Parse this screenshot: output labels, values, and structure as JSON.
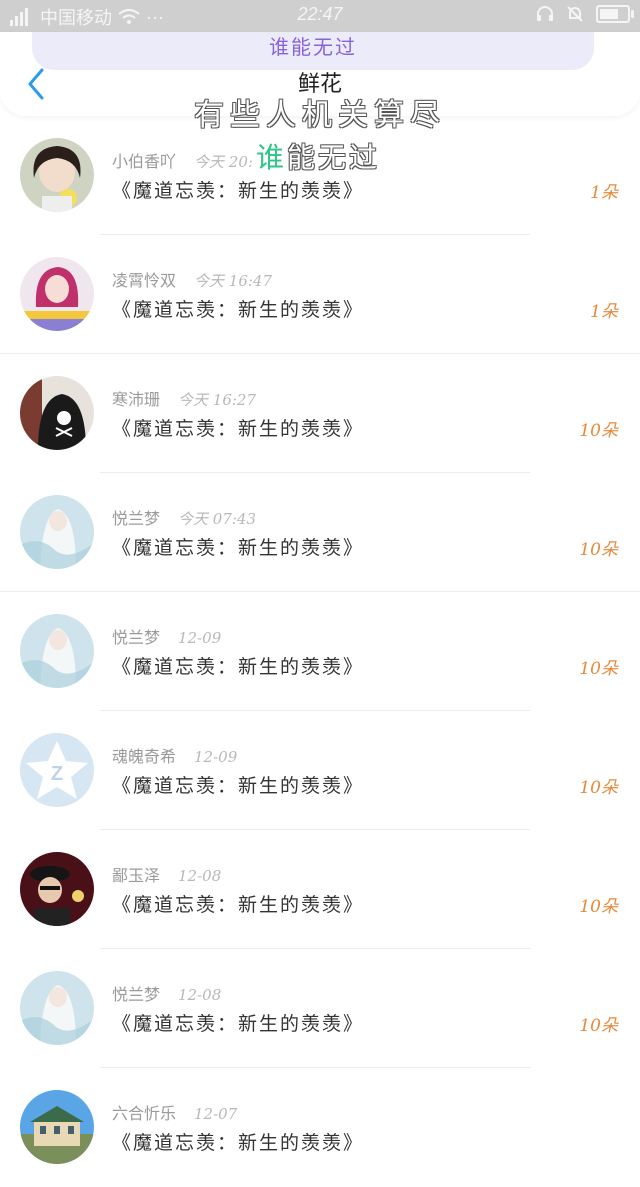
{
  "status_bar": {
    "carrier": "中国移动",
    "time": "22:47",
    "signal_icon": "signal-icon",
    "wifi_icon": "wifi-icon",
    "more_icon": "more-dots-icon",
    "headset_icon": "headset-icon",
    "mute_icon": "mute-icon",
    "battery_icon": "battery-icon"
  },
  "header": {
    "pill_text": "谁能无过",
    "title": "鲜花",
    "overlay_line1": "有些人机关算尽",
    "overlay_line2_highlight": "谁",
    "overlay_line2_rest": "能无过",
    "accent_color": "#8a64d6",
    "highlight_color": "#2fc58a"
  },
  "items": [
    {
      "name": "小伯香吖",
      "time": "今天 20:",
      "content": "《魔道忘羡：新生的羡羡》",
      "count": "1朵",
      "avatar": "girl-photo"
    },
    {
      "name": "凌霄怜双",
      "time": "今天 16:47",
      "content": "《魔道忘羡：新生的羡羡》",
      "count": "1朵",
      "avatar": "girl-pink"
    },
    {
      "name": "寒沛珊",
      "time": "今天 16:27",
      "content": "《魔道忘羡：新生的羡羡》",
      "count": "10朵",
      "avatar": "skull-hoodie"
    },
    {
      "name": "悦兰梦",
      "time": "今天 07:43",
      "content": "《魔道忘羡：新生的羡羡》",
      "count": "10朵",
      "avatar": "anime-white"
    },
    {
      "name": "悦兰梦",
      "time": "12-09",
      "content": "《魔道忘羡：新生的羡羡》",
      "count": "10朵",
      "avatar": "anime-white"
    },
    {
      "name": "魂魄奇希",
      "time": "12-09",
      "content": "《魔道忘羡：新生的羡羡》",
      "count": "10朵",
      "avatar": "default-z"
    },
    {
      "name": "鄙玉泽",
      "time": "12-08",
      "content": "《魔道忘羡：新生的羡羡》",
      "count": "10朵",
      "avatar": "boy-dark"
    },
    {
      "name": "悦兰梦",
      "time": "12-08",
      "content": "《魔道忘羡：新生的羡羡》",
      "count": "10朵",
      "avatar": "anime-white"
    },
    {
      "name": "六合忻乐",
      "time": "12-07",
      "content": "《魔道忘羡：新生的羡羡》",
      "count": "",
      "avatar": "building-sky"
    }
  ]
}
